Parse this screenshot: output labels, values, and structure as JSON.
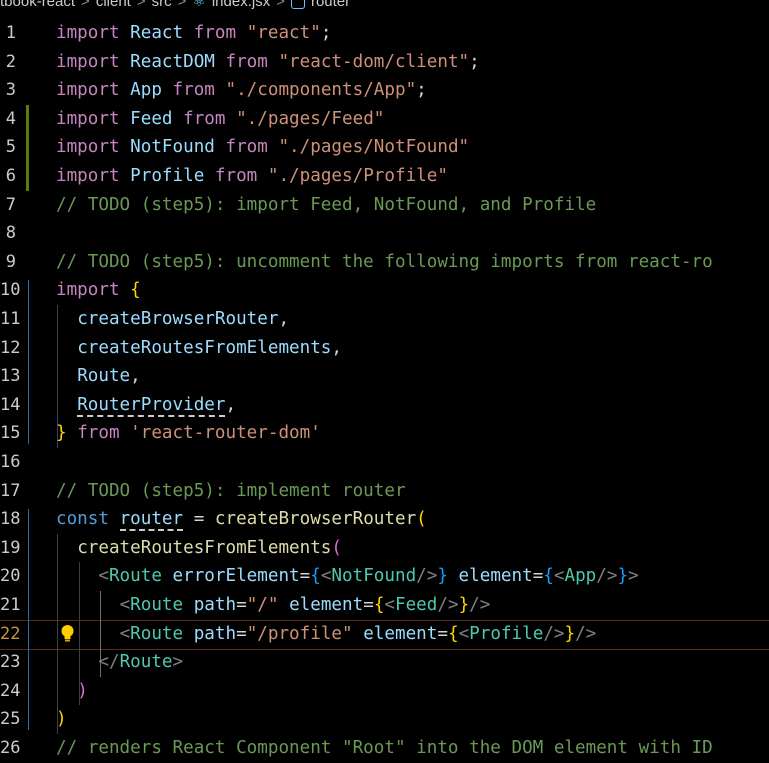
{
  "breadcrumb": {
    "items": [
      "tbook-react",
      "client",
      "src",
      "index.jsx",
      "router"
    ]
  },
  "editor": {
    "current_line": 22,
    "lines": [
      {
        "n": "1",
        "code": "<span class=kw2>import</span> <span class=id>React</span> <span class=kw2>from</span> <span class=str>\"react\"</span>;"
      },
      {
        "n": "2",
        "code": "<span class=kw2>import</span> <span class=id>ReactDOM</span> <span class=kw2>from</span> <span class=str>\"react-dom/client\"</span>;"
      },
      {
        "n": "3",
        "code": "<span class=kw2>import</span> <span class=id>App</span> <span class=kw2>from</span> <span class=str>\"./components/App\"</span>;"
      },
      {
        "n": "4",
        "code": "<span class=kw2>import</span> <span class=id>Feed</span> <span class=kw2>from</span> <span class=str>\"./pages/Feed\"</span>"
      },
      {
        "n": "5",
        "code": "<span class=kw2>import</span> <span class=id>NotFound</span> <span class=kw2>from</span> <span class=str>\"./pages/NotFound\"</span>"
      },
      {
        "n": "6",
        "code": "<span class=kw2>import</span> <span class=id>Profile</span> <span class=kw2>from</span> <span class=str>\"./pages/Profile\"</span>"
      },
      {
        "n": "7",
        "code": "<span class=cmt>// TODO (step5): import Feed, NotFound, and Profile</span>"
      },
      {
        "n": "8",
        "code": ""
      },
      {
        "n": "9",
        "code": "<span class=cmt>// TODO (step5): uncomment the following imports from react-ro</span>"
      },
      {
        "n": "10",
        "code": "<span class=kw2>import</span> <span class=brace1>{</span>"
      },
      {
        "n": "11",
        "code": "  <span class=id>createBrowserRouter</span>,"
      },
      {
        "n": "12",
        "code": "  <span class=id>createRoutesFromElements</span>,"
      },
      {
        "n": "13",
        "code": "  <span class=id>Route</span>,"
      },
      {
        "n": "14",
        "code": "  <span class=\"id squiggle\">RouterProvider</span>,"
      },
      {
        "n": "15",
        "code": "<span class=brace1>}</span> <span class=kw2>from</span> <span class=str>'react-router-dom'</span>"
      },
      {
        "n": "16",
        "code": ""
      },
      {
        "n": "17",
        "code": "<span class=cmt>// TODO (step5): implement router</span>"
      },
      {
        "n": "18",
        "code": "<span class=kw>const</span> <span class=\"id squiggle\">router</span> = <span class=fn>createBrowserRouter</span><span class=brace1>(</span>"
      },
      {
        "n": "19",
        "code": "  <span class=fn>createRoutesFromElements</span><span class=brace2>(</span>"
      },
      {
        "n": "20",
        "code": "    <span class=punct>&lt;</span><span class=tag>Route</span> <span class=id>errorElement</span>=<span class=brace3>{</span><span class=punct>&lt;</span><span class=tag>NotFound</span><span class=punct>/&gt;</span><span class=brace3>}</span> <span class=id>element</span>=<span class=brace3>{</span><span class=punct>&lt;</span><span class=tag>App</span><span class=punct>/&gt;</span><span class=brace3>}</span><span class=punct>&gt;</span>"
      },
      {
        "n": "21",
        "code": "      <span class=punct>&lt;</span><span class=tag>Route</span> <span class=id>path</span>=<span class=str>\"/\"</span> <span class=id>element</span>=<span class=brace1>{</span><span class=punct>&lt;</span><span class=tag>Feed</span><span class=punct>/&gt;</span><span class=brace1>}</span><span class=punct>/&gt;</span>"
      },
      {
        "n": "22",
        "code": "      <span class=punct>&lt;</span><span class=tag>Route</span> <span class=id>path</span>=<span class=str>\"/profile\"</span> <span class=id>element</span>=<span class=brace1>{</span><span class=punct>&lt;</span><span class=tag>Profile</span><span class=punct>/&gt;</span><span class=brace1>}</span><span class=punct>/&gt;</span>"
      },
      {
        "n": "23",
        "code": "    <span class=punct>&lt;/</span><span class=tag>Route</span><span class=punct>&gt;</span>"
      },
      {
        "n": "24",
        "code": "  <span class=brace2>)</span>"
      },
      {
        "n": "25",
        "code": "<span class=brace1>)</span>"
      },
      {
        "n": "26",
        "code": "<span class=cmt>// renders React Component \"Root\" into the DOM element with ID</span>"
      }
    ]
  },
  "colors": {
    "background": "#000000",
    "modified_gutter": "#587c0c",
    "current_line_number": "#c6963c"
  },
  "icons": {
    "breadcrumb_symbol": "symbol-variable-icon",
    "lightbulb": "lightbulb-icon"
  }
}
